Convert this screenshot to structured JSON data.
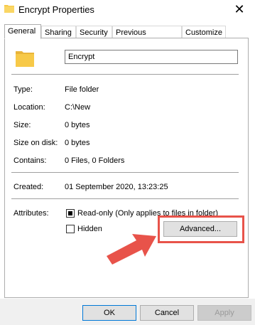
{
  "window": {
    "title": "Encrypt Properties",
    "close_glyph": "✕"
  },
  "tabs": [
    {
      "label": "General",
      "active": true
    },
    {
      "label": "Sharing",
      "active": false
    },
    {
      "label": "Security",
      "active": false
    },
    {
      "label": "Previous Versions",
      "active": false
    },
    {
      "label": "Customize",
      "active": false
    }
  ],
  "general": {
    "name_value": "Encrypt",
    "type_label": "Type:",
    "type_value": "File folder",
    "location_label": "Location:",
    "location_value": "C:\\New",
    "size_label": "Size:",
    "size_value": "0 bytes",
    "size_on_disk_label": "Size on disk:",
    "size_on_disk_value": "0 bytes",
    "contains_label": "Contains:",
    "contains_value": "0 Files, 0 Folders",
    "created_label": "Created:",
    "created_value": "01 September 2020, 13:23:25",
    "attributes_label": "Attributes:",
    "readonly_label": "Read-only (Only applies to files in folder)",
    "readonly_checked": true,
    "hidden_label": "Hidden",
    "hidden_checked": false,
    "advanced_label": "Advanced..."
  },
  "footer": {
    "ok_label": "OK",
    "cancel_label": "Cancel",
    "apply_label": "Apply"
  },
  "icons": {
    "folder_icon": "folder-icon",
    "close_icon": "close-icon",
    "arrow": "red-pointer-arrow"
  },
  "colors": {
    "highlight": "#e8534a",
    "folder": "#f7c948",
    "ok_border": "#0078d7"
  }
}
